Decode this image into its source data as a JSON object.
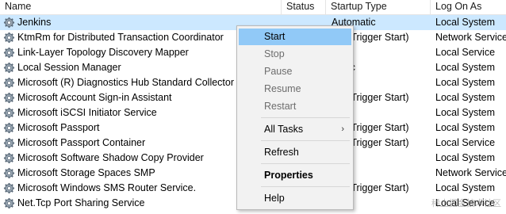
{
  "columns": {
    "name": "Name",
    "status": "Status",
    "startup_type": "Startup Type",
    "log_on_as": "Log On As"
  },
  "services": [
    {
      "name": "Jenkins",
      "status": "",
      "startup": "Automatic",
      "logon": "Local System",
      "selected": true
    },
    {
      "name": "KtmRm for Distributed Transaction Coordinator",
      "status": "",
      "startup": "ual (Trigger Start)",
      "logon": "Network Service"
    },
    {
      "name": "Link-Layer Topology Discovery Mapper",
      "status": "",
      "startup": "ual",
      "logon": "Local Service"
    },
    {
      "name": "Local Session Manager",
      "status": "",
      "startup": "matic",
      "logon": "Local System"
    },
    {
      "name": "Microsoft (R) Diagnostics Hub Standard Collector Se",
      "status": "",
      "startup": "ual",
      "logon": "Local System"
    },
    {
      "name": "Microsoft Account Sign-in Assistant",
      "status": "",
      "startup": "ual (Trigger Start)",
      "logon": "Local System"
    },
    {
      "name": "Microsoft iSCSI Initiator Service",
      "status": "",
      "startup": "ual",
      "logon": "Local System"
    },
    {
      "name": "Microsoft Passport",
      "status": "",
      "startup": "ual (Trigger Start)",
      "logon": "Local System"
    },
    {
      "name": "Microsoft Passport Container",
      "status": "",
      "startup": "ual (Trigger Start)",
      "logon": "Local Service"
    },
    {
      "name": "Microsoft Software Shadow Copy Provider",
      "status": "",
      "startup": "ual",
      "logon": "Local System"
    },
    {
      "name": "Microsoft Storage Spaces SMP",
      "status": "",
      "startup": "ual",
      "logon": "Network Service"
    },
    {
      "name": "Microsoft Windows SMS Router Service.",
      "status": "",
      "startup": "ual (Trigger Start)",
      "logon": "Local System"
    },
    {
      "name": "Net.Tcp Port Sharing Service",
      "status": "",
      "startup": "bled",
      "logon": "Local Service"
    }
  ],
  "context_menu": {
    "start": "Start",
    "stop": "Stop",
    "pause": "Pause",
    "resume": "Resume",
    "restart": "Restart",
    "all_tasks": "All Tasks",
    "all_tasks_arrow": "›",
    "refresh": "Refresh",
    "properties": "Properties",
    "help": "Help"
  },
  "watermark": "稀土掘金技术社区",
  "colors": {
    "selection": "#cce8ff",
    "menu_hover": "#91c9f7",
    "menu_bg": "#f2f2f2"
  }
}
